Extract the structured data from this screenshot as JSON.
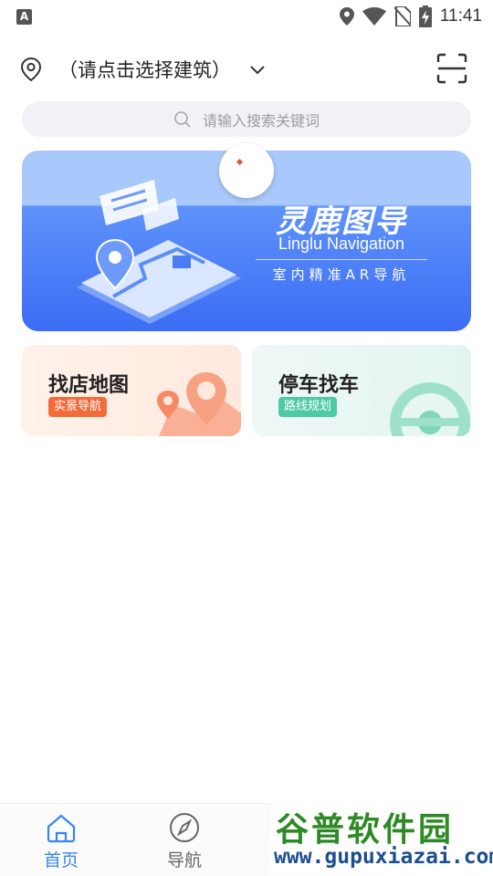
{
  "status_bar": {
    "time": "11:41",
    "icons": [
      "app-notification-icon",
      "location-icon",
      "wifi-icon",
      "no-sim-icon",
      "battery-charging-icon"
    ]
  },
  "header": {
    "building_placeholder": "（请点击选择建筑）",
    "icons": [
      "location-pin-icon",
      "chevron-down-icon",
      "scan-icon"
    ]
  },
  "search": {
    "placeholder": "请输入搜索关键词"
  },
  "banner": {
    "title": "灵鹿图导",
    "subtitle_en": "Linglu Navigation",
    "subtitle_cn": "室内精准AR导航"
  },
  "cards": [
    {
      "title": "找店地图",
      "badge": "实景导航",
      "accent": "#f26b3a"
    },
    {
      "title": "停车找车",
      "badge": "路线规划",
      "accent": "#4dc9a6"
    }
  ],
  "bottom_nav": {
    "items": [
      {
        "label": "首页",
        "icon": "home-icon",
        "active": true
      },
      {
        "label": "导航",
        "icon": "compass-icon",
        "active": false
      }
    ]
  },
  "watermark": {
    "name": "谷普软件园",
    "url": "www.gupuxiazai.com"
  },
  "colors": {
    "accent": "#3a84f0",
    "search_bg": "#f1f2f5",
    "banner_blue": "#3c6cf5"
  }
}
